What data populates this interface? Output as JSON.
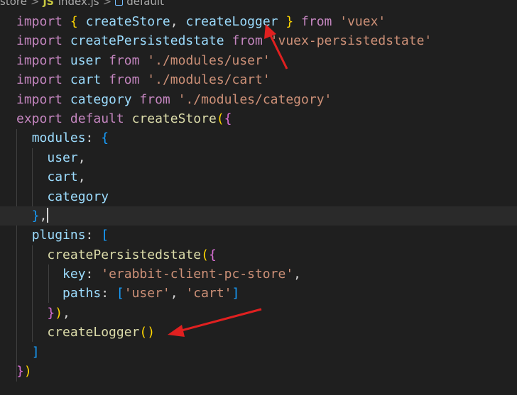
{
  "breadcrumb": {
    "folder": "store",
    "js_icon": "JS",
    "file": "index.js",
    "symbol": "default"
  },
  "code": {
    "line1": {
      "kw_import": "import",
      "brace_open": "{",
      "id1": "createStore",
      "comma": ",",
      "id2": "createLogger",
      "brace_close": "}",
      "kw_from": "from",
      "str": "'vuex'"
    },
    "line2": {
      "kw_import": "import",
      "id": "createPersistedstate",
      "kw_from": "from",
      "str": "'vuex-persistedstate'"
    },
    "line3": {
      "kw_import": "import",
      "id": "user",
      "kw_from": "from",
      "str": "'./modules/user'"
    },
    "line4": {
      "kw_import": "import",
      "id": "cart",
      "kw_from": "from",
      "str": "'./modules/cart'"
    },
    "line5": {
      "kw_import": "import",
      "id": "category",
      "kw_from": "from",
      "str": "'./modules/category'"
    },
    "line6": {
      "kw_export": "export",
      "kw_default": "default",
      "fn": "createStore",
      "paren": "(",
      "brace": "{"
    },
    "line7": {
      "key": "modules",
      "colon": ":",
      "brace": "{"
    },
    "line8": {
      "id": "user",
      "comma": ","
    },
    "line9": {
      "id": "cart",
      "comma": ","
    },
    "line10": {
      "id": "category"
    },
    "line11": {
      "brace": "}",
      "comma": ","
    },
    "line12": {
      "key": "plugins",
      "colon": ":",
      "bracket": "["
    },
    "line13": {
      "fn": "createPersistedstate",
      "paren": "(",
      "brace": "{"
    },
    "line14": {
      "key": "key",
      "colon": ":",
      "str": "'erabbit-client-pc-store'",
      "comma": ","
    },
    "line15": {
      "key": "paths",
      "colon": ":",
      "bracket_open": "[",
      "str1": "'user'",
      "comma": ",",
      "str2": "'cart'",
      "bracket_close": "]"
    },
    "line16": {
      "brace": "}",
      "paren": ")",
      "comma": ","
    },
    "line17": {
      "fn": "createLogger",
      "parens": "()"
    },
    "line18": {
      "bracket": "]"
    },
    "line19": {
      "brace": "}",
      "paren": ")"
    }
  },
  "colors": {
    "background": "#1f1f1f",
    "keyword": "#c586c0",
    "identifier": "#9cdcfe",
    "function": "#dcdcaa",
    "string": "#ce9178",
    "annotation_arrow": "#e02020"
  }
}
